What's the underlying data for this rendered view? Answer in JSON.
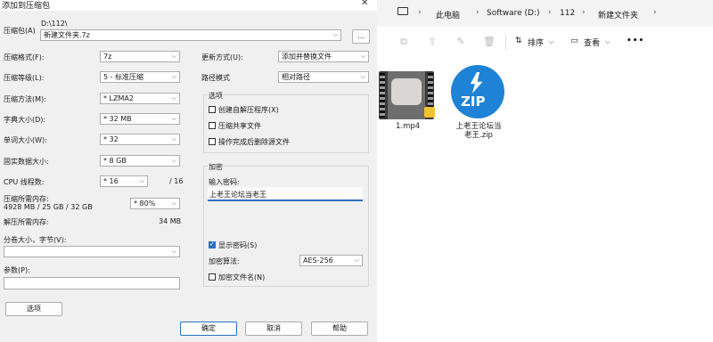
{
  "dialog": {
    "title": "添加到压缩包",
    "close": "✕",
    "archive_label": "压缩包(A)",
    "archive_path": "D:\\112\\",
    "archive_name": "新建文件夹.7z",
    "browse": "...",
    "format_label": "压缩格式(F):",
    "format_value": "7z",
    "level_label": "压缩等级(L):",
    "level_value": "5 - 标准压缩",
    "method_label": "压缩方法(M):",
    "method_value": "* LZMA2",
    "dict_label": "字典大小(D):",
    "dict_value": "* 32 MB",
    "word_label": "单词大小(W):",
    "word_value": "* 32",
    "solid_label": "固实数据大小:",
    "solid_value": "* 8 GB",
    "cpu_label": "CPU 线程数:",
    "cpu_value": "* 16",
    "cpu_total": "/ 16",
    "mem_compress_label": "压缩所需内存:",
    "mem_compress_value": "4928 MB / 25 GB / 32 GB",
    "mem_percent": "* 80%",
    "mem_decompress_label": "解压所需内存:",
    "mem_decompress_value": "34 MB",
    "split_label": "分卷大小，字节(V):",
    "params_label": "参数(P):",
    "options_button": "选项",
    "update_label": "更新方式(U):",
    "update_value": "添加并替换文件",
    "path_label": "路径模式",
    "path_value": "相对路径",
    "options_group": "选项",
    "opt_sfx": "创建自解压程序(X)",
    "opt_shared": "压缩共享文件",
    "opt_delete": "操作完成后删除源文件",
    "encrypt_group": "加密",
    "password_label": "输入密码:",
    "password_value": "上老王论坛当老王",
    "show_password": "显示密码(S)",
    "enc_method_label": "加密算法:",
    "enc_method_value": "AES-256",
    "encrypt_names": "加密文件名(N)",
    "ok": "确定",
    "cancel": "取消",
    "help": "帮助"
  },
  "explorer": {
    "breadcrumbs": [
      "此电脑",
      "Software (D:)",
      "112",
      "新建文件夹"
    ],
    "toolbar": {
      "sort": "排序",
      "view": "查看",
      "more": "•••"
    },
    "files": [
      {
        "name": "1.mp4",
        "icon": "video-thumbnail-icon"
      },
      {
        "name": "上老王论坛当老王.zip",
        "icon": "zip-icon",
        "badge": "ZIP"
      }
    ],
    "accent": "#1e82d6"
  }
}
